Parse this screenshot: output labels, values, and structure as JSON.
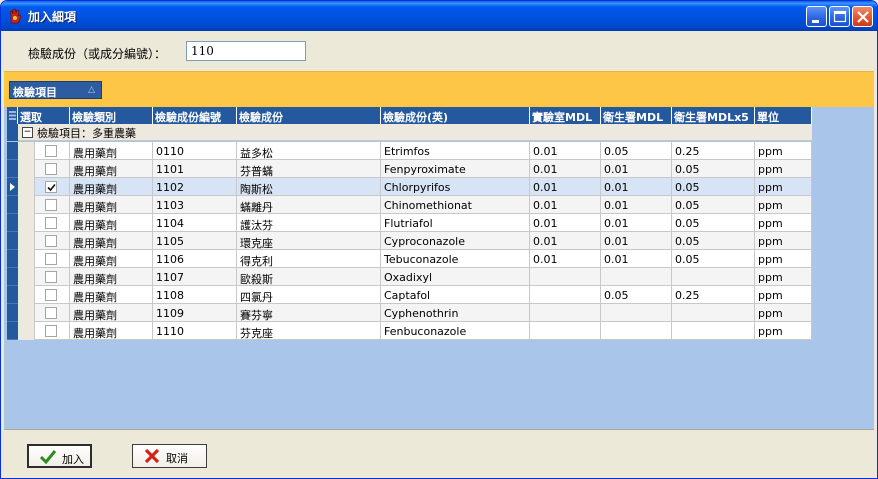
{
  "window": {
    "title": "加入細項",
    "icon": "app-hand-icon",
    "controls": [
      "minimize-icon",
      "maximize-icon",
      "close-icon"
    ]
  },
  "search": {
    "label": "檢驗成份（或成分編號）：",
    "value": "110"
  },
  "group_panel": {
    "chip_label": "檢驗項目",
    "chip_sort": "△"
  },
  "grid": {
    "columns": [
      "選取",
      "檢驗類別",
      "檢驗成份編號",
      "檢驗成份",
      "檢驗成份(英)",
      "實驗室MDL",
      "衛生署MDL",
      "衛生署MDLx5",
      "單位"
    ],
    "group_row": {
      "toggle": "−",
      "text": "檢驗項目：多重農藥"
    },
    "rows": [
      {
        "checked": false,
        "category": "農用藥劑",
        "code": "0110",
        "name": "益多松",
        "english": "Etrimfos",
        "lab_mdl": "0.01",
        "doh_mdl": "0.05",
        "doh_mdl_x5": "0.25",
        "unit": "ppm"
      },
      {
        "checked": false,
        "category": "農用藥劑",
        "code": "1101",
        "name": "芬普蟎",
        "english": "Fenpyroximate",
        "lab_mdl": "0.01",
        "doh_mdl": "0.01",
        "doh_mdl_x5": "0.05",
        "unit": "ppm"
      },
      {
        "checked": true,
        "category": "農用藥劑",
        "code": "1102",
        "name": "陶斯松",
        "english": "Chlorpyrifos",
        "lab_mdl": "0.01",
        "doh_mdl": "0.01",
        "doh_mdl_x5": "0.05",
        "unit": "ppm"
      },
      {
        "checked": false,
        "category": "農用藥劑",
        "code": "1103",
        "name": "蟎離丹",
        "english": "Chinomethionat",
        "lab_mdl": "0.01",
        "doh_mdl": "0.01",
        "doh_mdl_x5": "0.05",
        "unit": "ppm"
      },
      {
        "checked": false,
        "category": "農用藥劑",
        "code": "1104",
        "name": "護汰芬",
        "english": "Flutriafol",
        "lab_mdl": "0.01",
        "doh_mdl": "0.01",
        "doh_mdl_x5": "0.05",
        "unit": "ppm"
      },
      {
        "checked": false,
        "category": "農用藥劑",
        "code": "1105",
        "name": "環克座",
        "english": "Cyproconazole",
        "lab_mdl": "0.01",
        "doh_mdl": "0.01",
        "doh_mdl_x5": "0.05",
        "unit": "ppm"
      },
      {
        "checked": false,
        "category": "農用藥劑",
        "code": "1106",
        "name": "得克利",
        "english": "Tebuconazole",
        "lab_mdl": "0.01",
        "doh_mdl": "0.01",
        "doh_mdl_x5": "0.05",
        "unit": "ppm"
      },
      {
        "checked": false,
        "category": "農用藥劑",
        "code": "1107",
        "name": "歐殺斯",
        "english": "Oxadixyl",
        "lab_mdl": "",
        "doh_mdl": "",
        "doh_mdl_x5": "",
        "unit": "ppm"
      },
      {
        "checked": false,
        "category": "農用藥劑",
        "code": "1108",
        "name": "四氯丹",
        "english": "Captafol",
        "lab_mdl": "",
        "doh_mdl": "0.05",
        "doh_mdl_x5": "0.25",
        "unit": "ppm"
      },
      {
        "checked": false,
        "category": "農用藥劑",
        "code": "1109",
        "name": "賽芬寧",
        "english": "Cyphenothrin",
        "lab_mdl": "",
        "doh_mdl": "",
        "doh_mdl_x5": "",
        "unit": "ppm"
      },
      {
        "checked": false,
        "category": "農用藥劑",
        "code": "1110",
        "name": "芬克座",
        "english": "Fenbuconazole",
        "lab_mdl": "",
        "doh_mdl": "",
        "doh_mdl_x5": "",
        "unit": "ppm"
      }
    ],
    "current_row": 2
  },
  "buttons": {
    "ok_label": "加入",
    "ok_icon": "checkmark-icon",
    "cancel_label": "取消",
    "cancel_icon": "red-x-icon"
  },
  "colors": {
    "header_bg": "#24589f",
    "group_panel_bg": "#fdc646",
    "grid_background": "#a9c5ea",
    "selected_row": "#d7e4f5"
  }
}
